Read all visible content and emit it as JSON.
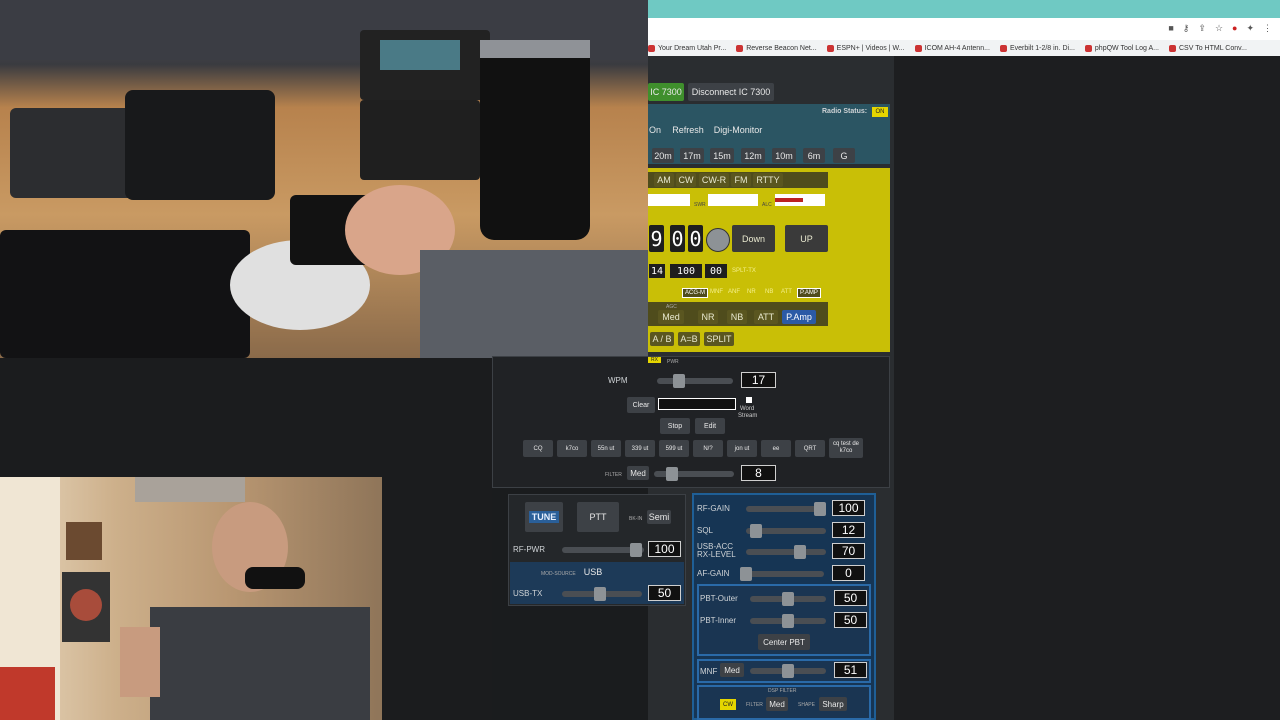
{
  "browser": {
    "bookmarks": [
      "Your Dream Utah Pr...",
      "Reverse Beacon Net...",
      "ESPN+ | Videos | W...",
      "ICOM AH-4 Antenn...",
      "Everbilt 1-2/8 in. Di...",
      "phpQW Tool Log A...",
      "CSV To HTML Conv..."
    ],
    "accent": "#6fc9c3"
  },
  "radio": {
    "connect_label": "IC 7300",
    "disconnect_label": "Disconnect IC 7300",
    "status_label": "Radio Status:",
    "status_value": "ON",
    "row2": {
      "on": "On",
      "refresh": "Refresh",
      "digi": "Digi-Monitor"
    },
    "bands": [
      "20m",
      "17m",
      "15m",
      "12m",
      "10m",
      "6m",
      "G"
    ],
    "modes": [
      "AM",
      "CW",
      "CW-R",
      "FM",
      "RTTY"
    ],
    "meter_labels": {
      "swr": "SWR",
      "alc": "ALC"
    },
    "freq_digits": [
      "9",
      "0",
      "0"
    ],
    "down_label": "Down",
    "up_label": "UP",
    "sub_freq": [
      "14",
      "100",
      "00"
    ],
    "split_tx": "SPLT-TX",
    "indicators": [
      "ACG-M",
      "MNF",
      "ANF",
      "NR",
      "NB",
      "ATT",
      "P.AMP"
    ],
    "agc_label": "AGC",
    "agc_value": "Med",
    "filters": [
      "NR",
      "NB",
      "ATT",
      "P.Amp"
    ],
    "vfo": [
      "A / B",
      "A=B",
      "SPLIT"
    ],
    "tx_tag": "RX",
    "pwr_tag": "PWR"
  },
  "keyer": {
    "wpm_label": "WPM",
    "wpm_value": "17",
    "clear_label": "Clear",
    "text_value": "",
    "word_label": "Word",
    "stream_label": "Stream",
    "stop_label": "Stop",
    "edit_label": "Edit",
    "macros": [
      "CQ",
      "k7co",
      "55n ut",
      "339 ut",
      "599 ut",
      "N/?",
      "jon ut",
      "ee",
      "QRT",
      "cq test de k7co"
    ],
    "filter_label": "FILTER",
    "filter_value": "Med",
    "filter_num": "8"
  },
  "tx": {
    "tune": "TUNE",
    "ptt": "PTT",
    "bkin_label": "BK-IN",
    "bkin_value": "Semi",
    "rfpwr_label": "RF-PWR",
    "rfpwr_value": "100",
    "mod_source_label": "MOD-SOURCE",
    "mod_source_value": "USB",
    "usbtx_label": "USB-TX",
    "usbtx_value": "50"
  },
  "rx": {
    "rfgain_label": "RF-GAIN",
    "rfgain_value": "100",
    "sql_label": "SQL",
    "sql_value": "12",
    "usbacc_label1": "USB-ACC",
    "usbacc_label2": "RX-LEVEL",
    "usbacc_value": "70",
    "afgain_label": "AF-GAIN",
    "afgain_value": "0",
    "pbt_outer_label": "PBT-Outer",
    "pbt_outer_value": "50",
    "pbt_inner_label": "PBT-Inner",
    "pbt_inner_value": "50",
    "center_pbt": "Center PBT",
    "mnf_label": "MNF",
    "mnf_value": "Med",
    "mnf_num": "51",
    "dsp_label": "DSP FILTER",
    "dsp_mode": "CW",
    "dsp_filter_label": "FILTER",
    "dsp_filter_value": "Med",
    "shape_label": "SHAPE",
    "shape_value": "Sharp"
  },
  "colors": {
    "yellow": "#c9bf06",
    "blue": "#1f5f96",
    "green": "#3f8f2c"
  }
}
